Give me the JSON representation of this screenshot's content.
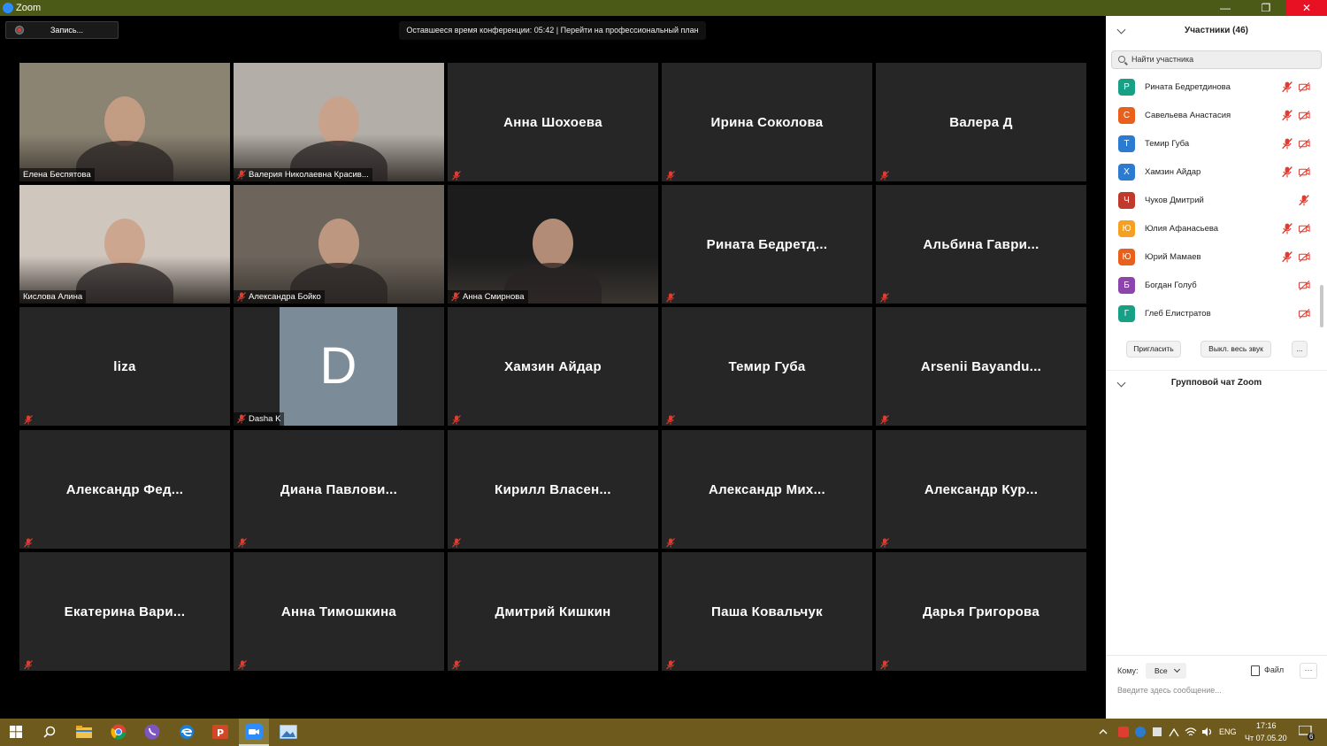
{
  "window": {
    "title": "Zoom",
    "minimize": "—",
    "restore": "❐",
    "close": "✕"
  },
  "toolbar": {
    "record_label": "Запись..."
  },
  "banner": {
    "text": "Оставшееся время конференции: 05:42 | Перейти на профессиональный план"
  },
  "tiles": [
    {
      "name": "Елена Беспятова",
      "kind": "video",
      "label": "Елена Беспятова",
      "muted": false,
      "active": true,
      "bg": "#8c8473"
    },
    {
      "name": "Валерия Николаевна Красив...",
      "kind": "video",
      "label": "Валерия Николаевна Красив...",
      "muted": true,
      "bg": "#b4aea8"
    },
    {
      "name": "Анна Шохоева",
      "kind": "name",
      "muted": true
    },
    {
      "name": "Ирина Соколова",
      "kind": "name",
      "muted": true
    },
    {
      "name": "Валера Д",
      "kind": "name",
      "muted": true
    },
    {
      "name": "Кислова Алина",
      "kind": "video",
      "label": "Кислова Алина",
      "muted": false,
      "bg": "#cfc6be"
    },
    {
      "name": "Александра Бойко",
      "kind": "video",
      "label": "Александра Бойко",
      "muted": true,
      "bg": "#6d655c"
    },
    {
      "name": "Анна Смирнова",
      "kind": "video",
      "label": "Анна Смирнова",
      "muted": true,
      "bg": "#1c1c1c"
    },
    {
      "name": "Рината Бедретд...",
      "kind": "name",
      "muted": true
    },
    {
      "name": "Альбина Гаври...",
      "kind": "name",
      "muted": true
    },
    {
      "name": "liza",
      "kind": "name",
      "muted": true
    },
    {
      "name": "Dasha K",
      "kind": "avatar",
      "label": "Dasha K",
      "letter": "D",
      "muted": true
    },
    {
      "name": "Хамзин Айдар",
      "kind": "name",
      "muted": true
    },
    {
      "name": "Темир Губа",
      "kind": "name",
      "muted": true
    },
    {
      "name": "Arsenii Bayandu...",
      "kind": "name",
      "muted": true
    },
    {
      "name": "Александр Фед...",
      "kind": "name",
      "muted": true
    },
    {
      "name": "Диана Павлови...",
      "kind": "name",
      "muted": true
    },
    {
      "name": "Кирилл Власен...",
      "kind": "name",
      "muted": true
    },
    {
      "name": "Александр Мих...",
      "kind": "name",
      "muted": true
    },
    {
      "name": "Александр Кур...",
      "kind": "name",
      "muted": true
    },
    {
      "name": "Екатерина Вари...",
      "kind": "name",
      "muted": true
    },
    {
      "name": "Анна Тимошкина",
      "kind": "name",
      "muted": true
    },
    {
      "name": "Дмитрий Кишкин",
      "kind": "name",
      "muted": true
    },
    {
      "name": "Паша Ковальчук",
      "kind": "name",
      "muted": true
    },
    {
      "name": "Дарья Григорова",
      "kind": "name",
      "muted": true
    }
  ],
  "panel": {
    "title": "Участники (46)",
    "search_placeholder": "Найти участника",
    "participants": [
      {
        "initial": "Р",
        "name": "Рината Бедретдинова",
        "color": "#17a086",
        "mic": true,
        "cam": true
      },
      {
        "initial": "С",
        "name": "Савельева Анастасия",
        "color": "#e8601c",
        "mic": true,
        "cam": true
      },
      {
        "initial": "Т",
        "name": "Темир Губа",
        "color": "#2b7bd1",
        "mic": true,
        "cam": true
      },
      {
        "initial": "Х",
        "name": "Хамзин Айдар",
        "color": "#2b7bd1",
        "mic": true,
        "cam": true
      },
      {
        "initial": "Ч",
        "name": "Чуков Дмитрий",
        "color": "#c0392b",
        "mic": true,
        "cam": false
      },
      {
        "initial": "Ю",
        "name": "Юлия Афанасьева",
        "color": "#f5a020",
        "mic": true,
        "cam": true
      },
      {
        "initial": "Ю",
        "name": "Юрий Мамаев",
        "color": "#e8601c",
        "mic": true,
        "cam": true
      },
      {
        "initial": "Б",
        "name": "Богдан Голуб",
        "color": "#8e44ad",
        "mic": false,
        "cam": true
      },
      {
        "initial": "Г",
        "name": "Глеб Елистратов",
        "color": "#17a086",
        "mic": false,
        "cam": true
      }
    ],
    "invite_label": "Пригласить",
    "mute_all_label": "Выкл. весь звук",
    "more_label": "...",
    "chat_title": "Групповой чат Zoom",
    "chat_to_label": "Кому:",
    "chat_to_value": "Все",
    "chat_file_label": "Файл",
    "chat_more_label": "···",
    "chat_placeholder": "Введите здесь сообщение..."
  },
  "taskbar": {
    "apps": [
      "windows-start",
      "search",
      "file-explorer",
      "chrome",
      "viber",
      "edge",
      "powerpoint",
      "zoom",
      "photos"
    ],
    "lang": "ENG",
    "time": "17:16",
    "date": "Чт 07.05.20",
    "notif_count": "6"
  }
}
